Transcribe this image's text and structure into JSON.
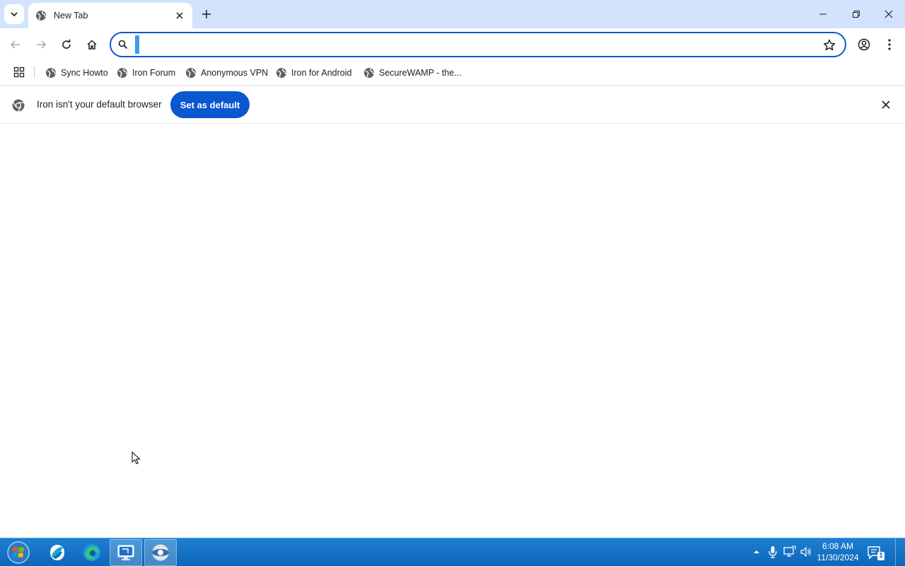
{
  "browser": {
    "tab": {
      "title": "New Tab"
    },
    "omnibox": {
      "value": "",
      "placeholder": ""
    },
    "bookmarks": [
      {
        "label": "Sync Howto"
      },
      {
        "label": "Iron Forum"
      },
      {
        "label": "Anonymous VPN"
      },
      {
        "label": "Iron for Android"
      },
      {
        "label": "SecureWAMP - the..."
      }
    ],
    "infobar": {
      "message": "Iron isn't your default browser",
      "button_label": "Set as default"
    },
    "accent_color": "#0b57d0"
  },
  "taskbar": {
    "clock_time": "6:08 AM",
    "clock_date": "11/30/2024",
    "notification_count": "1",
    "icons": [
      "start-orb-icon",
      "app-icon",
      "edge-icon",
      "remote-desktop-icon",
      "iron-browser-icon"
    ]
  }
}
